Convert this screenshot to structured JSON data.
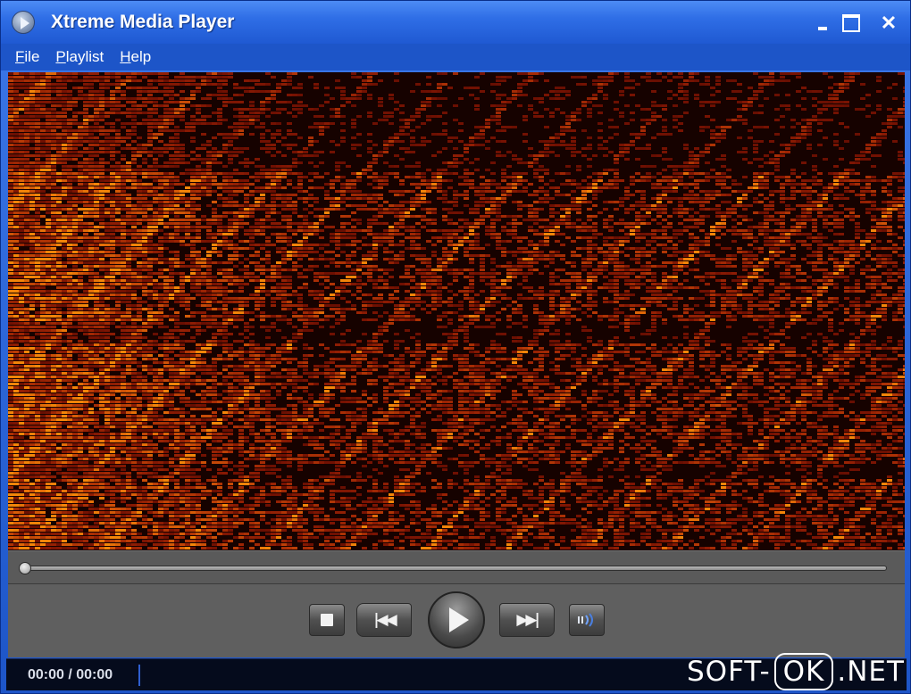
{
  "window": {
    "title": "Xtreme Media Player"
  },
  "menu": {
    "items": [
      "File",
      "Playlist",
      "Help"
    ]
  },
  "player": {
    "time_display": "00:00 / 00:00",
    "seek_position": 0
  },
  "watermark": {
    "left": "SOFT-",
    "boxed": "OK",
    "right": ".NET"
  },
  "icons": {
    "app": "media-player-icon",
    "stop": "stop-icon",
    "previous": "skip-back-icon",
    "play": "play-icon",
    "next": "skip-forward-icon",
    "volume": "volume-icon"
  },
  "colors": {
    "titlebar": "#2f6ee6",
    "visualization_dark": "#160200",
    "visualization_hot": "#ff5a10",
    "controls": "#5f5f5f"
  }
}
